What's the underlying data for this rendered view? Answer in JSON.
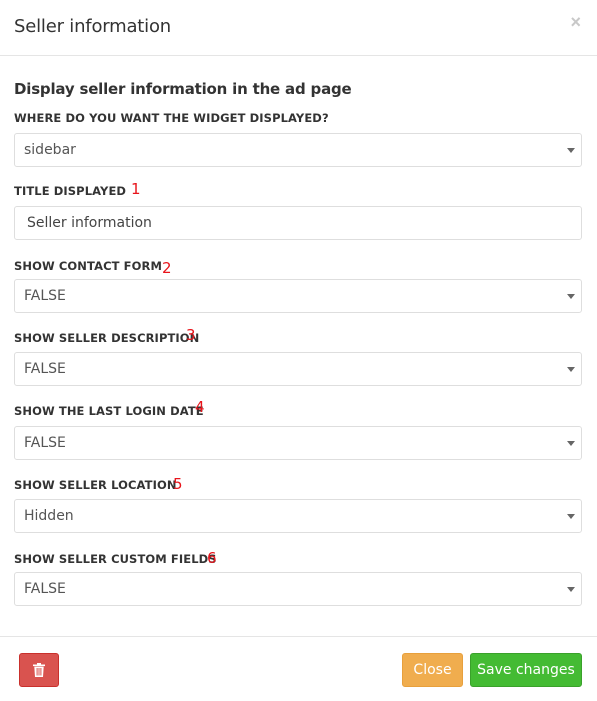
{
  "header": {
    "title": "Seller information",
    "close_symbol": "×"
  },
  "section": {
    "title": "Display seller information in the ad page"
  },
  "fields": [
    {
      "label": "WHERE DO YOU WANT THE WIDGET DISPLAYED?",
      "marker": "",
      "type": "select",
      "value": "sidebar"
    },
    {
      "label": "TITLE DISPLAYED",
      "marker": "1",
      "type": "input",
      "value": "Seller information"
    },
    {
      "label": "SHOW CONTACT FORM",
      "marker": "2",
      "type": "select",
      "value": "FALSE"
    },
    {
      "label": "SHOW SELLER DESCRIPTION",
      "marker": "3",
      "type": "select",
      "value": "FALSE"
    },
    {
      "label": "SHOW THE LAST LOGIN DATE",
      "marker": "4",
      "type": "select",
      "value": "FALSE"
    },
    {
      "label": "SHOW SELLER LOCATION",
      "marker": "5",
      "type": "select",
      "value": "Hidden"
    },
    {
      "label": "SHOW SELLER CUSTOM FIELDS",
      "marker": "6",
      "type": "select",
      "value": "FALSE"
    }
  ],
  "footer": {
    "delete_icon": "trash-icon",
    "close_label": "Close",
    "save_label": "Save changes"
  },
  "colors": {
    "marker": "#e8141b",
    "delete": "#d9534f",
    "close": "#f0ad4e",
    "save": "#44bb33"
  }
}
